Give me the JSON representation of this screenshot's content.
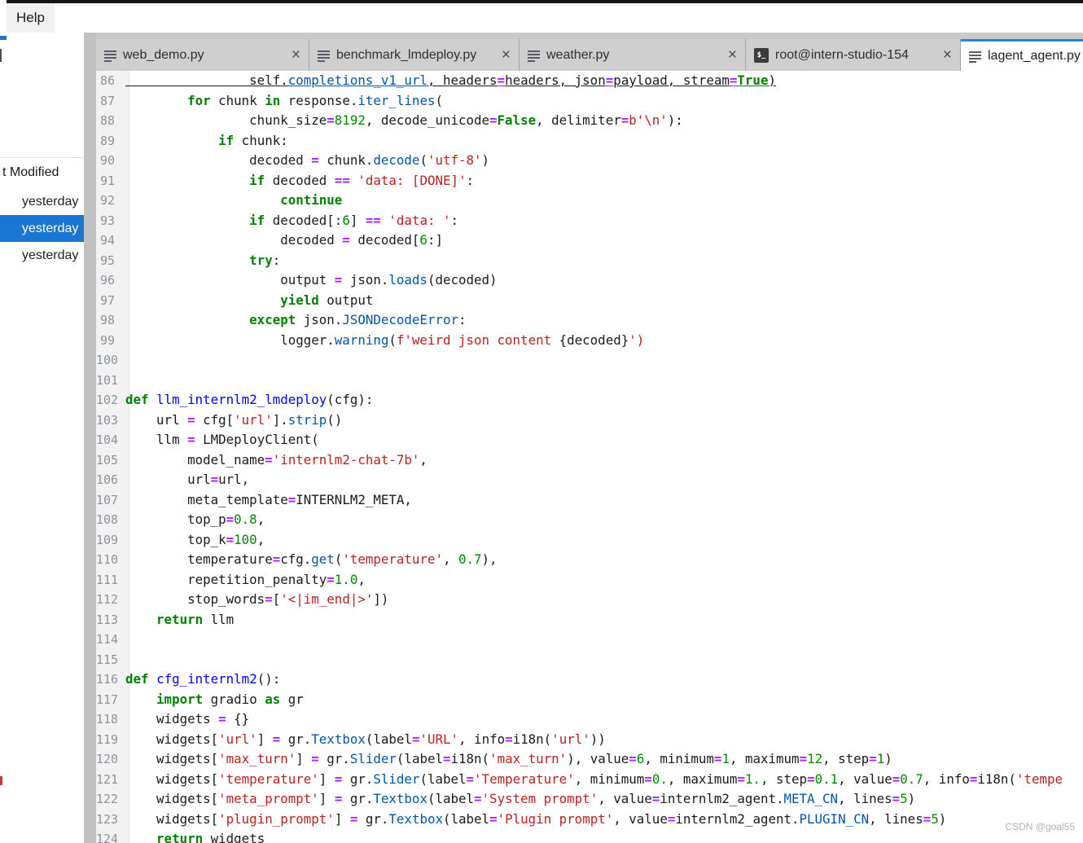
{
  "menubar": {
    "help_label": "Help"
  },
  "sidebar": {
    "header": "t Modified",
    "rows": [
      {
        "label": "yesterday",
        "selected": false
      },
      {
        "label": "yesterday",
        "selected": true
      },
      {
        "label": "yesterday",
        "selected": false
      }
    ]
  },
  "glyphs": {
    "close": "×",
    "terminal": "$_"
  },
  "colors": {
    "accent_blue": "#1e88e5",
    "selection_blue": "#1976d2",
    "tabbar_gray": "#c9c9c9",
    "keyword": "#008000",
    "operator": "#aa22ff",
    "string": "#ba2121",
    "number": "#008800",
    "property": "#0055aa",
    "definition": "#0000ff"
  },
  "tabs": [
    {
      "label": "web_demo.py",
      "icon": "file",
      "active": false,
      "closable": true
    },
    {
      "label": "benchmark_lmdeploy.py",
      "icon": "file",
      "active": false,
      "closable": true
    },
    {
      "label": "weather.py",
      "icon": "file",
      "active": false,
      "closable": true
    },
    {
      "label": "root@intern-studio-154",
      "icon": "terminal",
      "active": false,
      "closable": true
    },
    {
      "label": "lagent_agent.py",
      "icon": "file",
      "active": true,
      "closable": true
    }
  ],
  "editor": {
    "lines": [
      {
        "no": "86",
        "u": true,
        "seg": [
          [
            "                self.",
            "t"
          ],
          [
            "completions_v1_url",
            "p"
          ],
          [
            ", headers",
            "t"
          ],
          [
            "=",
            "o"
          ],
          [
            "headers, json",
            "t"
          ],
          [
            "=",
            "o"
          ],
          [
            "payload, stream",
            "t"
          ],
          [
            "=",
            "o"
          ],
          [
            "True",
            "k"
          ],
          [
            ")",
            "t"
          ]
        ]
      },
      {
        "no": "87",
        "seg": [
          [
            "        ",
            "t"
          ],
          [
            "for",
            "k"
          ],
          [
            " chunk ",
            "t"
          ],
          [
            "in",
            "k"
          ],
          [
            " response.",
            "t"
          ],
          [
            "iter_lines",
            "p"
          ],
          [
            "(",
            "t"
          ]
        ]
      },
      {
        "no": "88",
        "seg": [
          [
            "                chunk_size",
            "t"
          ],
          [
            "=",
            "o"
          ],
          [
            "8192",
            "n"
          ],
          [
            ", decode_unicode",
            "t"
          ],
          [
            "=",
            "o"
          ],
          [
            "False",
            "k"
          ],
          [
            ", delimiter",
            "t"
          ],
          [
            "=",
            "o"
          ],
          [
            "b'\\n'",
            "s"
          ],
          [
            "):",
            "t"
          ]
        ]
      },
      {
        "no": "89",
        "seg": [
          [
            "            ",
            "t"
          ],
          [
            "if",
            "k"
          ],
          [
            " chunk:",
            "t"
          ]
        ]
      },
      {
        "no": "90",
        "seg": [
          [
            "                decoded ",
            "t"
          ],
          [
            "=",
            "o"
          ],
          [
            " chunk.",
            "t"
          ],
          [
            "decode",
            "p"
          ],
          [
            "(",
            "t"
          ],
          [
            "'utf-8'",
            "s"
          ],
          [
            ")",
            "t"
          ]
        ]
      },
      {
        "no": "91",
        "seg": [
          [
            "                ",
            "t"
          ],
          [
            "if",
            "k"
          ],
          [
            " decoded ",
            "t"
          ],
          [
            "==",
            "o"
          ],
          [
            " ",
            "t"
          ],
          [
            "'data: [DONE]'",
            "s"
          ],
          [
            ":",
            "t"
          ]
        ]
      },
      {
        "no": "92",
        "seg": [
          [
            "                    ",
            "t"
          ],
          [
            "continue",
            "k"
          ]
        ]
      },
      {
        "no": "93",
        "seg": [
          [
            "                ",
            "t"
          ],
          [
            "if",
            "k"
          ],
          [
            " decoded[:",
            "t"
          ],
          [
            "6",
            "n"
          ],
          [
            "] ",
            "t"
          ],
          [
            "==",
            "o"
          ],
          [
            " ",
            "t"
          ],
          [
            "'data: '",
            "s"
          ],
          [
            ":",
            "t"
          ]
        ]
      },
      {
        "no": "94",
        "seg": [
          [
            "                    decoded ",
            "t"
          ],
          [
            "=",
            "o"
          ],
          [
            " decoded[",
            "t"
          ],
          [
            "6",
            "n"
          ],
          [
            ":]",
            "t"
          ]
        ]
      },
      {
        "no": "95",
        "seg": [
          [
            "                ",
            "t"
          ],
          [
            "try",
            "k"
          ],
          [
            ":",
            "t"
          ]
        ]
      },
      {
        "no": "96",
        "seg": [
          [
            "                    output ",
            "t"
          ],
          [
            "=",
            "o"
          ],
          [
            " json.",
            "t"
          ],
          [
            "loads",
            "p"
          ],
          [
            "(decoded)",
            "t"
          ]
        ]
      },
      {
        "no": "97",
        "seg": [
          [
            "                    ",
            "t"
          ],
          [
            "yield",
            "k"
          ],
          [
            " output",
            "t"
          ]
        ]
      },
      {
        "no": "98",
        "seg": [
          [
            "                ",
            "t"
          ],
          [
            "except",
            "k"
          ],
          [
            " json.",
            "t"
          ],
          [
            "JSONDecodeError",
            "p"
          ],
          [
            ":",
            "t"
          ]
        ]
      },
      {
        "no": "99",
        "seg": [
          [
            "                    logger.",
            "t"
          ],
          [
            "warning",
            "p"
          ],
          [
            "(",
            "t"
          ],
          [
            "f'weird json content ",
            "s"
          ],
          [
            "{decoded}",
            "t"
          ],
          [
            "')",
            "s"
          ]
        ]
      },
      {
        "no": "100",
        "seg": []
      },
      {
        "no": "101",
        "seg": []
      },
      {
        "no": "102",
        "seg": [
          [
            "def",
            "k"
          ],
          [
            " ",
            "t"
          ],
          [
            "llm_internlm2_lmdeploy",
            "d"
          ],
          [
            "(cfg):",
            "t"
          ]
        ]
      },
      {
        "no": "103",
        "seg": [
          [
            "    url ",
            "t"
          ],
          [
            "=",
            "o"
          ],
          [
            " cfg[",
            "t"
          ],
          [
            "'url'",
            "s"
          ],
          [
            "].",
            "t"
          ],
          [
            "strip",
            "p"
          ],
          [
            "()",
            "t"
          ]
        ]
      },
      {
        "no": "104",
        "seg": [
          [
            "    llm ",
            "t"
          ],
          [
            "=",
            "o"
          ],
          [
            " LMDeployClient(",
            "t"
          ]
        ]
      },
      {
        "no": "105",
        "seg": [
          [
            "        model_name",
            "t"
          ],
          [
            "=",
            "o"
          ],
          [
            "'internlm2-chat-7b'",
            "s"
          ],
          [
            ",",
            "t"
          ]
        ]
      },
      {
        "no": "106",
        "seg": [
          [
            "        url",
            "t"
          ],
          [
            "=",
            "o"
          ],
          [
            "url,",
            "t"
          ]
        ]
      },
      {
        "no": "107",
        "seg": [
          [
            "        meta_template",
            "t"
          ],
          [
            "=",
            "o"
          ],
          [
            "INTERNLM2_META,",
            "t"
          ]
        ]
      },
      {
        "no": "108",
        "seg": [
          [
            "        top_p",
            "t"
          ],
          [
            "=",
            "o"
          ],
          [
            "0.8",
            "n"
          ],
          [
            ",",
            "t"
          ]
        ]
      },
      {
        "no": "109",
        "seg": [
          [
            "        top_k",
            "t"
          ],
          [
            "=",
            "o"
          ],
          [
            "100",
            "n"
          ],
          [
            ",",
            "t"
          ]
        ]
      },
      {
        "no": "110",
        "seg": [
          [
            "        temperature",
            "t"
          ],
          [
            "=",
            "o"
          ],
          [
            "cfg.",
            "t"
          ],
          [
            "get",
            "p"
          ],
          [
            "(",
            "t"
          ],
          [
            "'temperature'",
            "s"
          ],
          [
            ", ",
            "t"
          ],
          [
            "0.7",
            "n"
          ],
          [
            "),",
            "t"
          ]
        ]
      },
      {
        "no": "111",
        "seg": [
          [
            "        repetition_penalty",
            "t"
          ],
          [
            "=",
            "o"
          ],
          [
            "1.0",
            "n"
          ],
          [
            ",",
            "t"
          ]
        ]
      },
      {
        "no": "112",
        "seg": [
          [
            "        stop_words",
            "t"
          ],
          [
            "=",
            "o"
          ],
          [
            "[",
            "t"
          ],
          [
            "'<|im_end|>'",
            "s"
          ],
          [
            "])",
            "t"
          ]
        ]
      },
      {
        "no": "113",
        "seg": [
          [
            "    ",
            "t"
          ],
          [
            "return",
            "k"
          ],
          [
            " llm",
            "t"
          ]
        ]
      },
      {
        "no": "114",
        "seg": []
      },
      {
        "no": "115",
        "seg": []
      },
      {
        "no": "116",
        "seg": [
          [
            "def",
            "k"
          ],
          [
            " ",
            "t"
          ],
          [
            "cfg_internlm2",
            "d"
          ],
          [
            "():",
            "t"
          ]
        ]
      },
      {
        "no": "117",
        "seg": [
          [
            "    ",
            "t"
          ],
          [
            "import",
            "k"
          ],
          [
            " gradio ",
            "t"
          ],
          [
            "as",
            "k"
          ],
          [
            " gr",
            "t"
          ]
        ]
      },
      {
        "no": "118",
        "seg": [
          [
            "    widgets ",
            "t"
          ],
          [
            "=",
            "o"
          ],
          [
            " {}",
            "t"
          ]
        ]
      },
      {
        "no": "119",
        "seg": [
          [
            "    widgets[",
            "t"
          ],
          [
            "'url'",
            "s"
          ],
          [
            "] ",
            "t"
          ],
          [
            "=",
            "o"
          ],
          [
            " gr.",
            "t"
          ],
          [
            "Textbox",
            "p"
          ],
          [
            "(label",
            "t"
          ],
          [
            "=",
            "o"
          ],
          [
            "'URL'",
            "s"
          ],
          [
            ", info",
            "t"
          ],
          [
            "=",
            "o"
          ],
          [
            "i18n(",
            "t"
          ],
          [
            "'url'",
            "s"
          ],
          [
            "))",
            "t"
          ]
        ]
      },
      {
        "no": "120",
        "seg": [
          [
            "    widgets[",
            "t"
          ],
          [
            "'max_turn'",
            "s"
          ],
          [
            "] ",
            "t"
          ],
          [
            "=",
            "o"
          ],
          [
            " gr.",
            "t"
          ],
          [
            "Slider",
            "p"
          ],
          [
            "(label",
            "t"
          ],
          [
            "=",
            "o"
          ],
          [
            "i18n(",
            "t"
          ],
          [
            "'max_turn'",
            "s"
          ],
          [
            "), value",
            "t"
          ],
          [
            "=",
            "o"
          ],
          [
            "6",
            "n"
          ],
          [
            ", minimum",
            "t"
          ],
          [
            "=",
            "o"
          ],
          [
            "1",
            "n"
          ],
          [
            ", maximum",
            "t"
          ],
          [
            "=",
            "o"
          ],
          [
            "12",
            "n"
          ],
          [
            ", step",
            "t"
          ],
          [
            "=",
            "o"
          ],
          [
            "1",
            "n"
          ],
          [
            ")",
            "t"
          ]
        ]
      },
      {
        "no": "121",
        "seg": [
          [
            "    widgets[",
            "t"
          ],
          [
            "'temperature'",
            "s"
          ],
          [
            "] ",
            "t"
          ],
          [
            "=",
            "o"
          ],
          [
            " gr.",
            "t"
          ],
          [
            "Slider",
            "p"
          ],
          [
            "(label",
            "t"
          ],
          [
            "=",
            "o"
          ],
          [
            "'Temperature'",
            "s"
          ],
          [
            ", minimum",
            "t"
          ],
          [
            "=",
            "o"
          ],
          [
            "0.",
            "n"
          ],
          [
            ", maximum",
            "t"
          ],
          [
            "=",
            "o"
          ],
          [
            "1.",
            "n"
          ],
          [
            ", step",
            "t"
          ],
          [
            "=",
            "o"
          ],
          [
            "0.1",
            "n"
          ],
          [
            ", value",
            "t"
          ],
          [
            "=",
            "o"
          ],
          [
            "0.7",
            "n"
          ],
          [
            ", info",
            "t"
          ],
          [
            "=",
            "o"
          ],
          [
            "i18n(",
            "t"
          ],
          [
            "'tempe",
            "s"
          ]
        ]
      },
      {
        "no": "122",
        "seg": [
          [
            "    widgets[",
            "t"
          ],
          [
            "'meta_prompt'",
            "s"
          ],
          [
            "] ",
            "t"
          ],
          [
            "=",
            "o"
          ],
          [
            " gr.",
            "t"
          ],
          [
            "Textbox",
            "p"
          ],
          [
            "(label",
            "t"
          ],
          [
            "=",
            "o"
          ],
          [
            "'System prompt'",
            "s"
          ],
          [
            ", value",
            "t"
          ],
          [
            "=",
            "o"
          ],
          [
            "internlm2_agent.",
            "t"
          ],
          [
            "META_CN",
            "p"
          ],
          [
            ", lines",
            "t"
          ],
          [
            "=",
            "o"
          ],
          [
            "5",
            "n"
          ],
          [
            ")",
            "t"
          ]
        ]
      },
      {
        "no": "123",
        "seg": [
          [
            "    widgets[",
            "t"
          ],
          [
            "'plugin_prompt'",
            "s"
          ],
          [
            "] ",
            "t"
          ],
          [
            "=",
            "o"
          ],
          [
            " gr.",
            "t"
          ],
          [
            "Textbox",
            "p"
          ],
          [
            "(label",
            "t"
          ],
          [
            "=",
            "o"
          ],
          [
            "'Plugin prompt'",
            "s"
          ],
          [
            ", value",
            "t"
          ],
          [
            "=",
            "o"
          ],
          [
            "internlm2_agent.",
            "t"
          ],
          [
            "PLUGIN_CN",
            "p"
          ],
          [
            ", lines",
            "t"
          ],
          [
            "=",
            "o"
          ],
          [
            "5",
            "n"
          ],
          [
            ")",
            "t"
          ]
        ]
      },
      {
        "no": "124",
        "seg": [
          [
            "    ",
            "t"
          ],
          [
            "return",
            "k"
          ],
          [
            " widgets",
            "t"
          ]
        ]
      }
    ]
  },
  "watermark": "CSDN @goal55"
}
